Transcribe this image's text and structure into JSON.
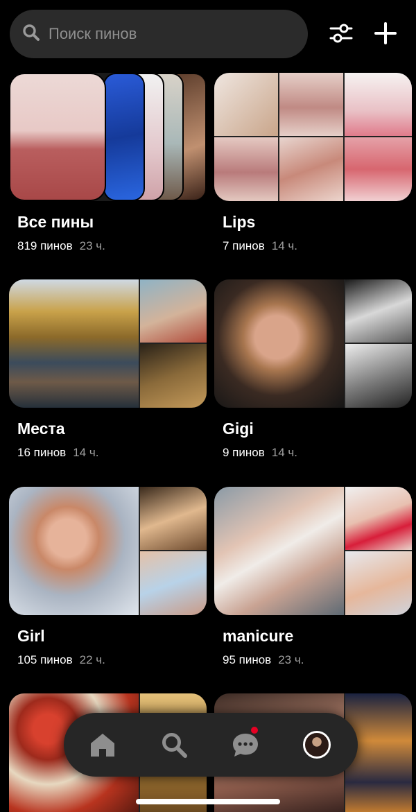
{
  "search": {
    "placeholder": "Поиск пинов"
  },
  "icons": {
    "search": "search-icon",
    "filters": "sliders-icon",
    "create": "plus-icon",
    "home": "home-icon",
    "explore": "search-icon",
    "messages": "chat-bubble-icon",
    "profile": "avatar"
  },
  "boards": [
    {
      "name": "Все пины",
      "count": "819 пинов",
      "time": "23 ч."
    },
    {
      "name": "Lips",
      "count": "7 пинов",
      "time": "14 ч."
    },
    {
      "name": "Места",
      "count": "16 пинов",
      "time": "14 ч."
    },
    {
      "name": "Gigi",
      "count": "9 пинов",
      "time": "14 ч."
    },
    {
      "name": "Girl",
      "count": "105 пинов",
      "time": "22 ч."
    },
    {
      "name": "manicure",
      "count": "95 пинов",
      "time": "23 ч."
    }
  ],
  "nav": {
    "messages_badge": true
  },
  "colors": {
    "background": "#000000",
    "surface": "#2b2b2b",
    "badge": "#e60023",
    "secondary_text": "#a0a0a0"
  }
}
